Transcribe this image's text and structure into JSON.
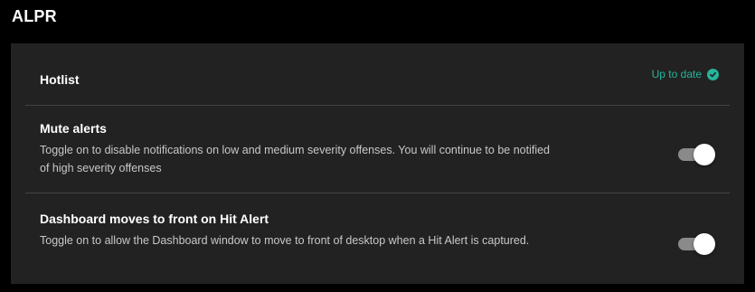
{
  "section": {
    "title": "ALPR"
  },
  "hotlist": {
    "title": "Hotlist",
    "status_text": "Up to date",
    "status_icon": "check-circle-icon",
    "status_color": "#26b59a"
  },
  "mute_alerts": {
    "title": "Mute alerts",
    "description": "Toggle on to disable notifications on low and medium severity offenses. You will continue to be notified of high severity offenses",
    "enabled": true
  },
  "dashboard_front": {
    "title": "Dashboard moves to front on Hit Alert",
    "description": "Toggle on to allow the Dashboard window to move to front of desktop when a Hit Alert is captured.",
    "enabled": true
  },
  "colors": {
    "background": "#000000",
    "panel": "#222222",
    "divider": "#444444",
    "toggle_track": "#8a8a8a",
    "toggle_thumb": "#ffffff"
  }
}
